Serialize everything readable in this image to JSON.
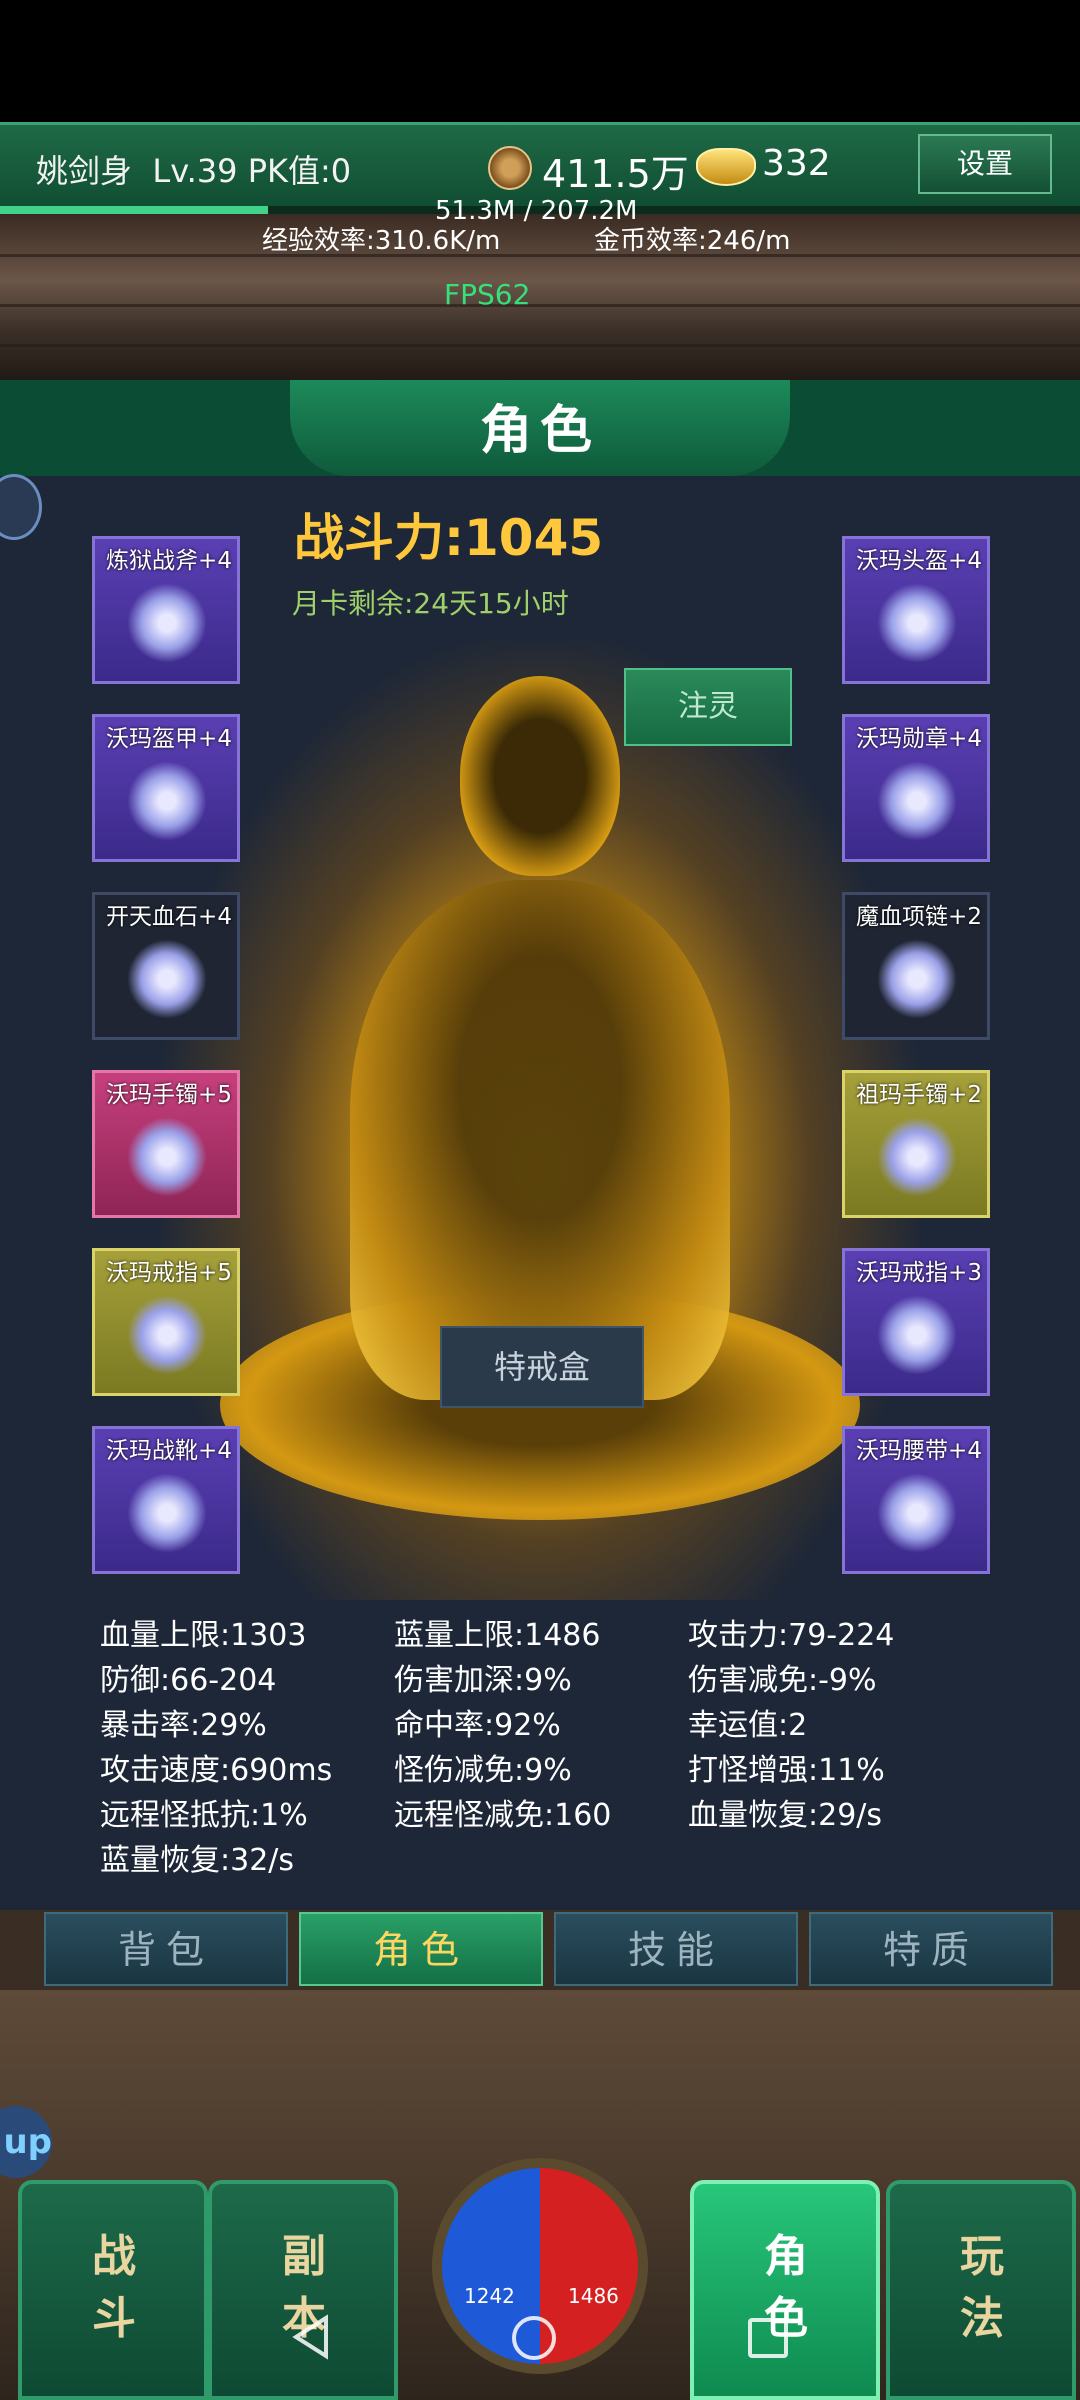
{
  "header": {
    "player_name": "姚剑身",
    "level": "Lv.39",
    "pk": "PK值:0",
    "coins": "411.5万",
    "ingots": "332",
    "settings_label": "设置",
    "exp_text": "51.3M / 207.2M",
    "exp_fraction": 0.248,
    "exp_efficiency": "经验效率:310.6K/m",
    "gold_efficiency": "金币效率:246/m",
    "fps": "FPS62"
  },
  "panel": {
    "title": "角色",
    "power": "战斗力:1045",
    "month_card": "月卡剩余:24天15小时",
    "infuse_button": "注灵",
    "ring_box_button": "特戒盒"
  },
  "equipment_left": [
    {
      "label": "炼狱战斧+4",
      "quality": "purple",
      "icon": "axe-icon"
    },
    {
      "label": "沃玛盔甲+4",
      "quality": "purple",
      "icon": "armor-icon"
    },
    {
      "label": "开天血石+4",
      "quality": "dark",
      "icon": "stone-icon"
    },
    {
      "label": "沃玛手镯+5",
      "quality": "pink",
      "icon": "bracelet-icon"
    },
    {
      "label": "沃玛戒指+5",
      "quality": "yellow",
      "icon": "ring-icon"
    },
    {
      "label": "沃玛战靴+4",
      "quality": "purple",
      "icon": "boots-icon"
    }
  ],
  "equipment_right": [
    {
      "label": "沃玛头盔+4",
      "quality": "purple",
      "icon": "helmet-icon"
    },
    {
      "label": "沃玛勋章+4",
      "quality": "purple",
      "icon": "medal-icon"
    },
    {
      "label": "魔血项链+2",
      "quality": "dark",
      "icon": "necklace-icon"
    },
    {
      "label": "祖玛手镯+2",
      "quality": "yellow",
      "icon": "bracelet-icon"
    },
    {
      "label": "沃玛戒指+3",
      "quality": "purple",
      "icon": "ring-icon"
    },
    {
      "label": "沃玛腰带+4",
      "quality": "purple",
      "icon": "belt-icon"
    }
  ],
  "stats": [
    [
      "血量上限:1303",
      "蓝量上限:1486",
      "攻击力:79-224"
    ],
    [
      "防御:66-204",
      "伤害加深:9%",
      "伤害减免:-9%"
    ],
    [
      "暴击率:29%",
      "命中率:92%",
      "幸运值:2"
    ],
    [
      "攻击速度:690ms",
      "怪伤减免:9%",
      "打怪增强:11%"
    ],
    [
      "远程怪抵抗:1%",
      "远程怪减免:160",
      "血量恢复:29/s"
    ],
    [
      "蓝量恢复:32/s",
      "",
      ""
    ]
  ],
  "tabs": [
    {
      "label": "背包",
      "active": false
    },
    {
      "label": "角色",
      "active": true
    },
    {
      "label": "技能",
      "active": false
    },
    {
      "label": "特质",
      "active": false
    }
  ],
  "nav": [
    {
      "top": "战",
      "bottom": "斗",
      "active": false
    },
    {
      "top": "副",
      "bottom": "本",
      "active": false
    },
    {
      "top": "角",
      "bottom": "色",
      "active": true
    },
    {
      "top": "玩",
      "bottom": "法",
      "active": false
    }
  ],
  "orb": {
    "hp": "1242",
    "mp": "1486"
  },
  "up_label": "up"
}
